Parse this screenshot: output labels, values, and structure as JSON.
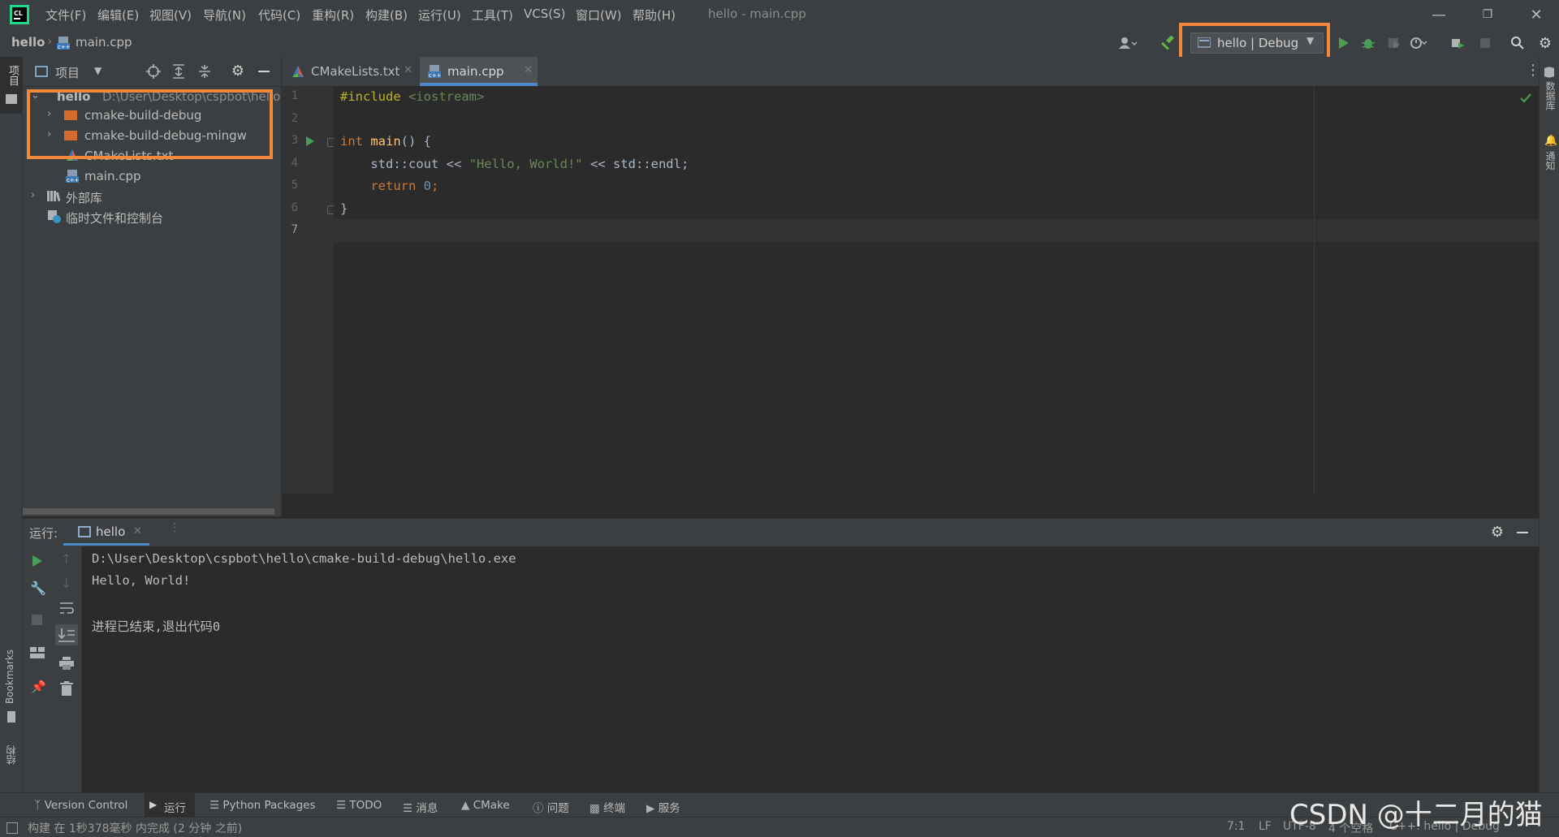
{
  "menu": [
    "文件(F)",
    "编辑(E)",
    "视图(V)",
    "导航(N)",
    "代码(C)",
    "重构(R)",
    "构建(B)",
    "运行(U)",
    "工具(T)",
    "VCS(S)",
    "窗口(W)",
    "帮助(H)"
  ],
  "window_title": "hello - main.cpp",
  "breadcrumb": {
    "project": "hello",
    "file": "main.cpp"
  },
  "run_config": "hello | Debug",
  "left_stripe": {
    "project_label": "项目",
    "bookmarks_label": "Bookmarks",
    "structure_label": "结构"
  },
  "right_stripe": {
    "database_label": "数据库",
    "notifications_label": "通知"
  },
  "project_panel": {
    "title": "项目",
    "tree": [
      {
        "label": "hello",
        "path": "D:\\User\\Desktop\\cspbot\\hello"
      },
      {
        "label": "cmake-build-debug"
      },
      {
        "label": "cmake-build-debug-mingw"
      },
      {
        "label": "CMakeLists.txt"
      },
      {
        "label": "main.cpp"
      },
      {
        "label": "外部库"
      },
      {
        "label": "临时文件和控制台"
      }
    ]
  },
  "editor": {
    "tabs": [
      {
        "label": "CMakeLists.txt",
        "active": false
      },
      {
        "label": "main.cpp",
        "active": true
      }
    ],
    "line_numbers": [
      "1",
      "2",
      "3",
      "4",
      "5",
      "6",
      "7"
    ],
    "code": {
      "l1_directive": "#include",
      "l1_header": "<iostream>",
      "l3_kw": "int",
      "l3_fn": "main",
      "l3_rest": "() {",
      "l4_a": "    std::cout << ",
      "l4_str": "\"Hello, World!\"",
      "l4_b": " << std::endl;",
      "l5_kw": "    return",
      "l5_num": "0",
      "l5_end": ";",
      "l6": "}"
    }
  },
  "run_panel": {
    "label": "运行:",
    "tab": "hello",
    "output": [
      "D:\\User\\Desktop\\cspbot\\hello\\cmake-build-debug\\hello.exe",
      "Hello, World!",
      "",
      "进程已结束,退出代码0"
    ]
  },
  "bottom_tools": [
    "Version Control",
    "运行",
    "Python Packages",
    "TODO",
    "消息",
    "CMake",
    "问题",
    "终端",
    "服务"
  ],
  "status": {
    "message": "构建 在 1秒378毫秒 内完成 (2 分钟 之前)",
    "position": "7:1",
    "line_sep": "LF",
    "encoding": "UTF-8",
    "indent": "4 个空格",
    "context": "C++: hello | Debug"
  },
  "watermark": "CSDN @十二月的猫",
  "colors": {
    "accent_orange": "#f2883a",
    "run_green": "#499c54",
    "background": "#2b2b2b"
  }
}
